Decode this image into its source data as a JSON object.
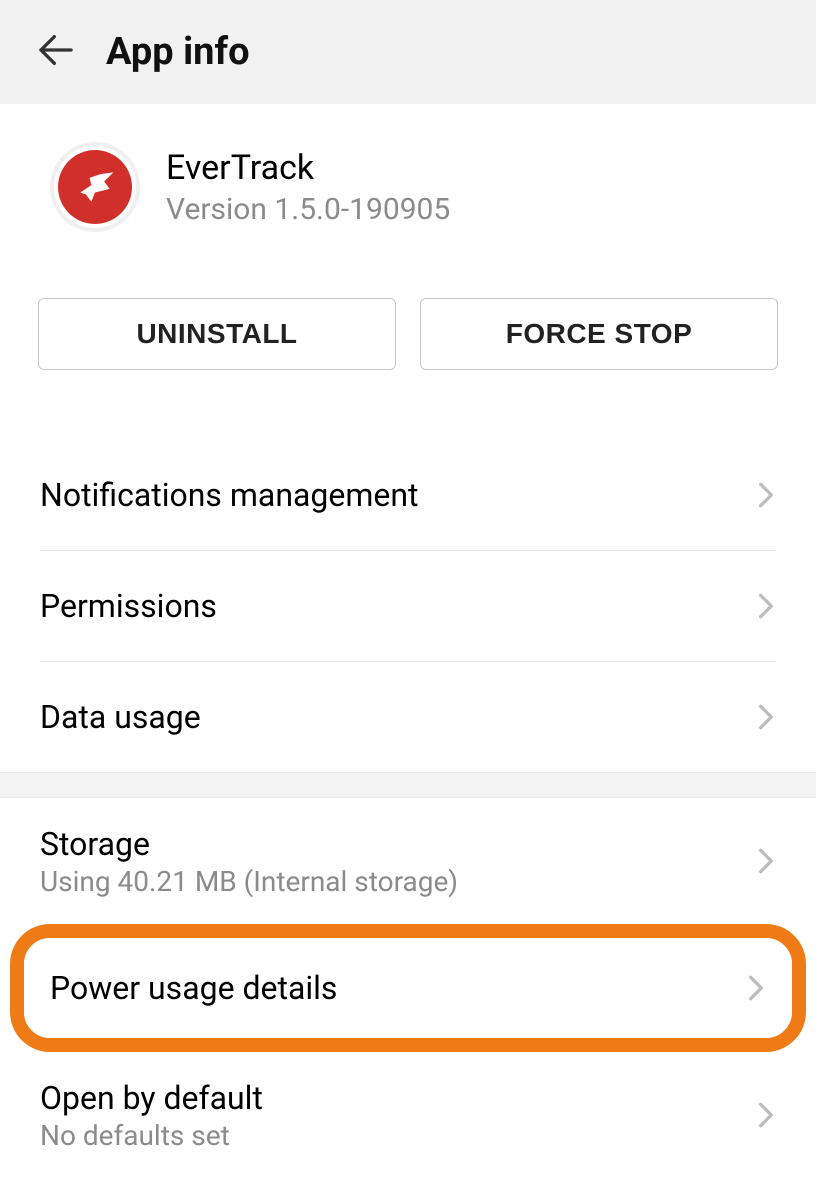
{
  "header": {
    "title": "App info"
  },
  "app": {
    "name": "EverTrack",
    "version": "Version 1.5.0-190905",
    "icon_name": "evertrack-bird-icon",
    "icon_bg": "#d12f2a"
  },
  "buttons": {
    "uninstall": "UNINSTALL",
    "force_stop": "FORCE STOP"
  },
  "section1": [
    {
      "title": "Notifications management"
    },
    {
      "title": "Permissions"
    },
    {
      "title": "Data usage"
    }
  ],
  "section2": {
    "storage": {
      "title": "Storage",
      "sub": "Using 40.21 MB (Internal storage)"
    },
    "power": {
      "title": "Power usage details"
    },
    "open": {
      "title": "Open by default",
      "sub": "No defaults set"
    }
  },
  "highlight_color": "#ef7b16"
}
